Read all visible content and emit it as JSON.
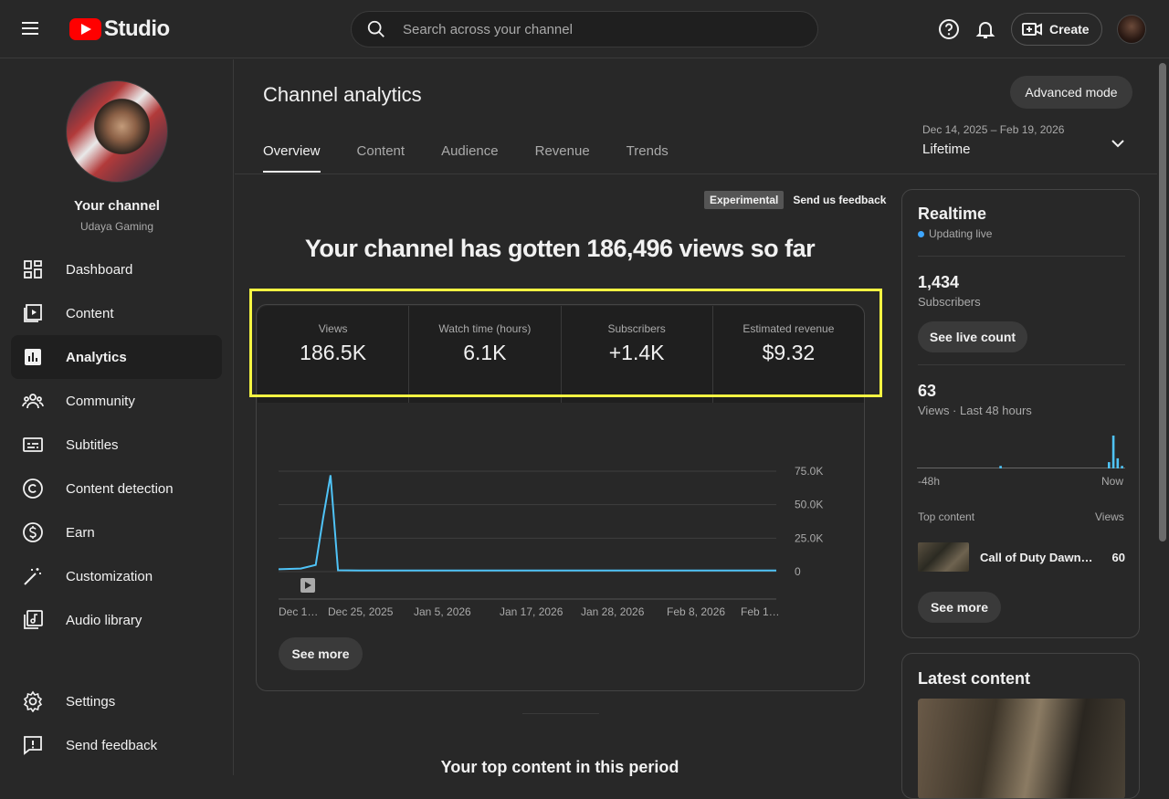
{
  "header": {
    "logo_text": "Studio",
    "search_placeholder": "Search across your channel",
    "create_label": "Create"
  },
  "sidebar": {
    "channel_name": "Your channel",
    "channel_handle": "Udaya Gaming",
    "items": [
      {
        "label": "Dashboard",
        "icon": "dashboard-icon"
      },
      {
        "label": "Content",
        "icon": "content-icon"
      },
      {
        "label": "Analytics",
        "icon": "analytics-icon",
        "active": true
      },
      {
        "label": "Community",
        "icon": "community-icon"
      },
      {
        "label": "Subtitles",
        "icon": "subtitles-icon"
      },
      {
        "label": "Content detection",
        "icon": "copyright-icon"
      },
      {
        "label": "Earn",
        "icon": "earn-icon"
      },
      {
        "label": "Customization",
        "icon": "customization-icon"
      },
      {
        "label": "Audio library",
        "icon": "audio-library-icon"
      }
    ],
    "bottom_items": [
      {
        "label": "Settings",
        "icon": "gear-icon"
      },
      {
        "label": "Send feedback",
        "icon": "feedback-icon"
      }
    ]
  },
  "main": {
    "title": "Channel analytics",
    "advanced_mode_label": "Advanced mode",
    "tabs": [
      {
        "label": "Overview",
        "active": true
      },
      {
        "label": "Content"
      },
      {
        "label": "Audience"
      },
      {
        "label": "Revenue"
      },
      {
        "label": "Trends"
      }
    ],
    "date_range": "Dec 14, 2025 – Feb 19, 2026",
    "date_preset": "Lifetime",
    "experimental_badge": "Experimental",
    "feedback_link": "Send us feedback",
    "headline": "Your channel has gotten 186,496 views so far",
    "metrics": [
      {
        "label": "Views",
        "value": "186.5K"
      },
      {
        "label": "Watch time (hours)",
        "value": "6.1K"
      },
      {
        "label": "Subscribers",
        "value": "+1.4K"
      },
      {
        "label": "Estimated revenue",
        "value": "$9.32"
      }
    ],
    "see_more_label": "See more",
    "top_content_title": "Your top content in this period"
  },
  "chart_data": {
    "type": "line",
    "x": [
      "Dec 14",
      "Dec 17",
      "Dec 19",
      "Dec 20",
      "Dec 21",
      "Dec 22",
      "Dec 25",
      "Jan 5",
      "Jan 17",
      "Jan 28",
      "Feb 8",
      "Feb 19"
    ],
    "series": [
      {
        "values": [
          1800,
          2300,
          5000,
          40000,
          72000,
          1000,
          800,
          800,
          800,
          800,
          800,
          800
        ]
      }
    ],
    "x_tick_labels": [
      "Dec 1…",
      "Dec 25, 2025",
      "Jan 5, 2026",
      "Jan 17, 2026",
      "Jan 28, 2026",
      "Feb 8, 2026",
      "Feb 1…"
    ],
    "y_tick_labels": [
      "75.0K",
      "50.0K",
      "25.0K",
      "0"
    ],
    "ylim": [
      0,
      75000
    ],
    "line_color": "#4fc3f7",
    "grid": true
  },
  "realtime": {
    "title": "Realtime",
    "status": "Updating live",
    "subscribers_value": "1,434",
    "subscribers_label": "Subscribers",
    "live_count_label": "See live count",
    "views_value": "63",
    "views_label": "Views · Last 48 hours",
    "axis_start": "-48h",
    "axis_end": "Now",
    "hourly_views": [
      0,
      0,
      0,
      0,
      0,
      0,
      0,
      0,
      0,
      0,
      0,
      0,
      0,
      0,
      0,
      0,
      0,
      0,
      0,
      2,
      0,
      0,
      0,
      0,
      0,
      0,
      0,
      0,
      0,
      0,
      0,
      0,
      0,
      0,
      0,
      0,
      0,
      0,
      0,
      0,
      0,
      0,
      0,
      0,
      5,
      26,
      8,
      2
    ],
    "top_content_header": "Top content",
    "views_header": "Views",
    "top_content_title": "Call of Duty Dawnvi…",
    "top_content_views": "60",
    "see_more_label": "See more"
  },
  "latest": {
    "title": "Latest content"
  }
}
